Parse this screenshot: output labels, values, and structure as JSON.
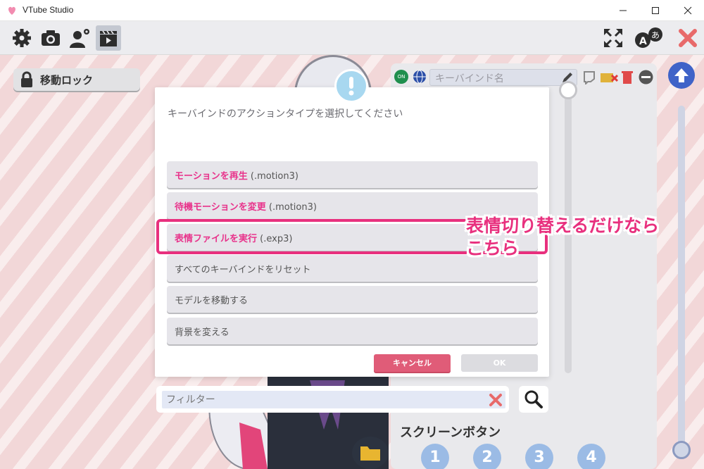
{
  "window": {
    "title": "VTube Studio"
  },
  "sidebar": {
    "lock_label": "移動ロック"
  },
  "right_panel": {
    "keybind_placeholder": "キーバインド名",
    "on_badge": "ON",
    "screen_buttons_title": "スクリーンボタン",
    "screen_buttons": [
      "1",
      "2",
      "3",
      "4"
    ]
  },
  "dialog": {
    "title": "キーバインドのアクションタイプを選択してください",
    "options": [
      {
        "main": "モーションを再生",
        "suffix": " (.motion3)"
      },
      {
        "main": "待機モーションを変更",
        "suffix": " (.motion3)"
      },
      {
        "main": "表情ファイルを実行",
        "suffix": " (.exp3)"
      },
      {
        "main": "すべてのキーバインドをリセット",
        "suffix": ""
      },
      {
        "main": "モデルを移動する",
        "suffix": ""
      },
      {
        "main": "背景を変える",
        "suffix": ""
      }
    ],
    "cancel_label": "キャンセル",
    "ok_label": "OK"
  },
  "filter": {
    "placeholder": "フィルター"
  },
  "annotation": {
    "line1": "表情切り替えるだけなら",
    "line2": "こちら"
  },
  "colors": {
    "accent_pink": "#e8307e",
    "cancel_red": "#e05c78",
    "up_blue": "#3f63c8"
  }
}
